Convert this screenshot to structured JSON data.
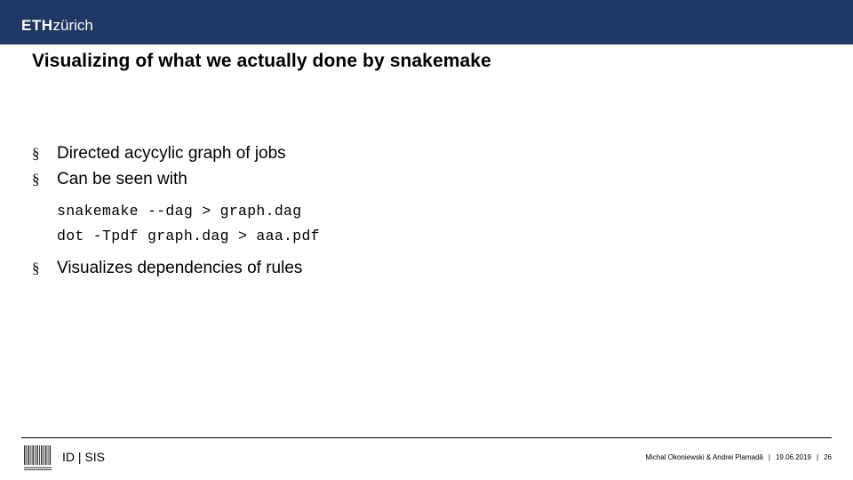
{
  "banner": {
    "logo_eth": "ETH",
    "logo_zurich": "zürich",
    "bg_color": "#1f3864"
  },
  "title": "Visualizing of what we actually done by snakemake",
  "bullets": [
    {
      "marker": "§",
      "text": "Directed acycylic graph of jobs"
    },
    {
      "marker": "§",
      "text": "Can be seen with"
    }
  ],
  "code": [
    "snakemake --dag > graph.dag",
    "dot -Tpdf graph.dag > aaa.pdf"
  ],
  "bullet_last": {
    "marker": "§",
    "text": "Visualizes dependencies of rules"
  },
  "footer": {
    "department": "ID | SIS",
    "authors": "Michal Okoniewski & Andrei Plamadă",
    "separator": "|",
    "date": "19.06.2019",
    "page": "26"
  }
}
